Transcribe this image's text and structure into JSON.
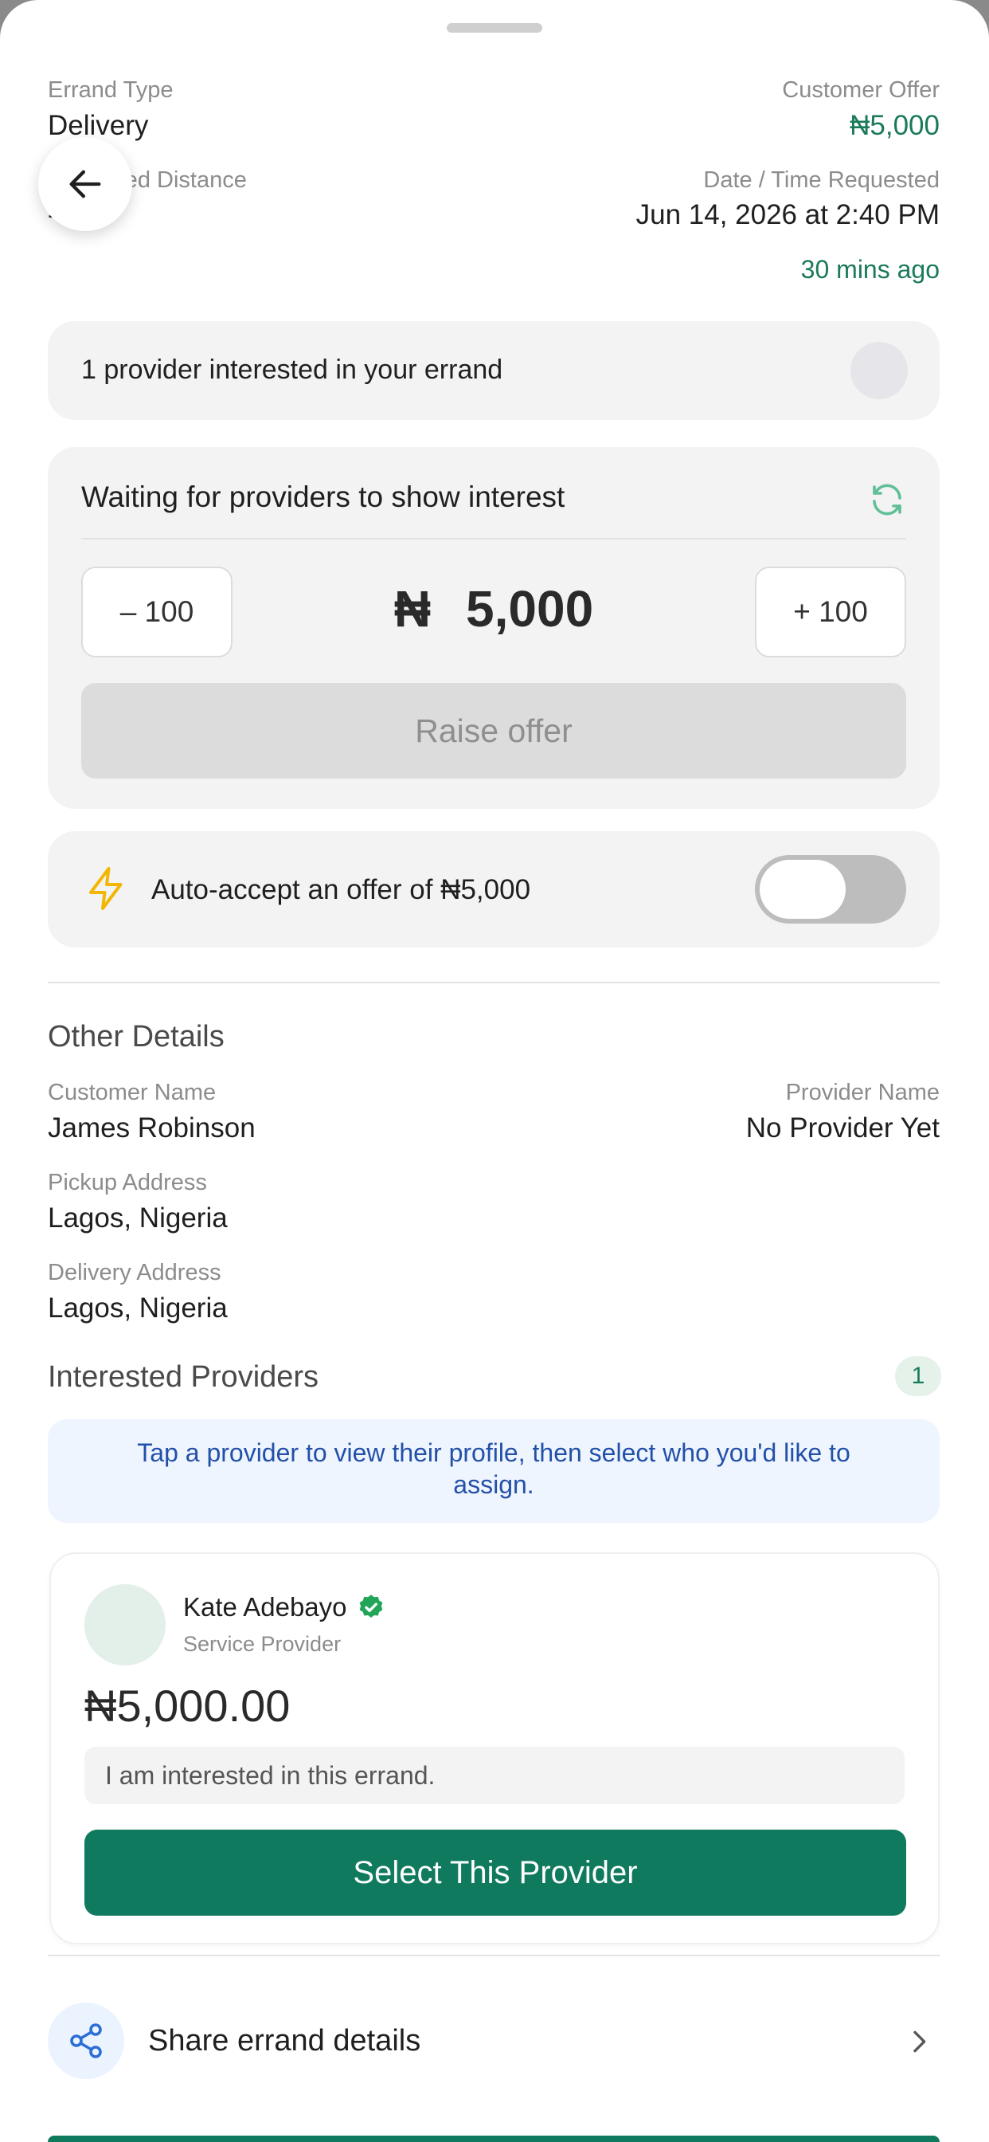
{
  "summary": {
    "errand_type_label": "Errand Type",
    "errand_type_value": "Delivery",
    "customer_offer_label": "Customer Offer",
    "customer_offer_value": "₦5,000",
    "distance_label": "Estimated Distance",
    "distance_value": "-",
    "date_label": "Date / Time Requested",
    "date_value": "Jun 14, 2026 at 2:40 PM",
    "time_ago": "30 mins ago"
  },
  "interest": {
    "text": "1 provider interested in your errand"
  },
  "offer": {
    "waiting_text": "Waiting for providers to show interest",
    "minus_label": "– 100",
    "plus_label": "+ 100",
    "currency": "₦",
    "amount": "5,000",
    "raise_label": "Raise offer"
  },
  "auto_accept": {
    "text": "Auto-accept an offer of ₦5,000",
    "enabled": false
  },
  "other_details": {
    "heading": "Other Details",
    "customer_name_label": "Customer Name",
    "customer_name_value": "James Robinson",
    "provider_name_label": "Provider Name",
    "provider_name_value": "No Provider Yet",
    "pickup_label": "Pickup Address",
    "pickup_value": "Lagos, Nigeria",
    "delivery_label": "Delivery Address",
    "delivery_value": "Lagos, Nigeria"
  },
  "providers": {
    "heading": "Interested Providers",
    "count": "1",
    "info": "Tap a provider to view their profile, then select who you'd like to assign.",
    "items": [
      {
        "name": "Kate Adebayo",
        "role": "Service Provider",
        "price": "₦5,000.00",
        "message": "I am interested in this errand.",
        "select_label": "Select This Provider"
      }
    ]
  },
  "share": {
    "label": "Share errand details"
  },
  "colors": {
    "accent": "#0f7a5e",
    "offer_green": "#1a7a5a",
    "info_blue": "#2350a8",
    "verified_green": "#22a559",
    "bolt_yellow": "#f2b705"
  }
}
